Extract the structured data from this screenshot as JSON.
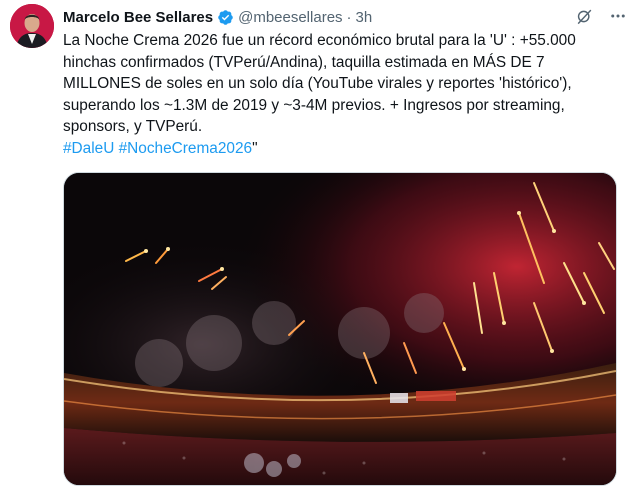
{
  "author": {
    "name": "Marcelo Bee Sellares",
    "handle": "@mbeesellares",
    "time": "3h",
    "separator": "·"
  },
  "icons": {
    "verified": "verified-badge-icon",
    "grok": "grok-icon",
    "more": "more-icon"
  },
  "tweet": {
    "text": "La Noche Crema 2026 fue un récord económico brutal para la 'U' : +55.000\nhinchas confirmados (TVPerú/Andina), taquilla estimada en MÁS DE 7\nMILLONES de soles en un solo día (YouTube virales y reportes 'histórico'),\nsuperando los ~1.3M de 2019 y ~3-4M previos. + Ingresos por streaming,\nsponsors, y TVPerú.",
    "hashtags": [
      "#DaleU",
      "#NocheCrema2026"
    ],
    "trailing": "\""
  },
  "colors": {
    "link": "#1d9bf0",
    "verified": "#1d9bf0",
    "muted": "#536471"
  }
}
